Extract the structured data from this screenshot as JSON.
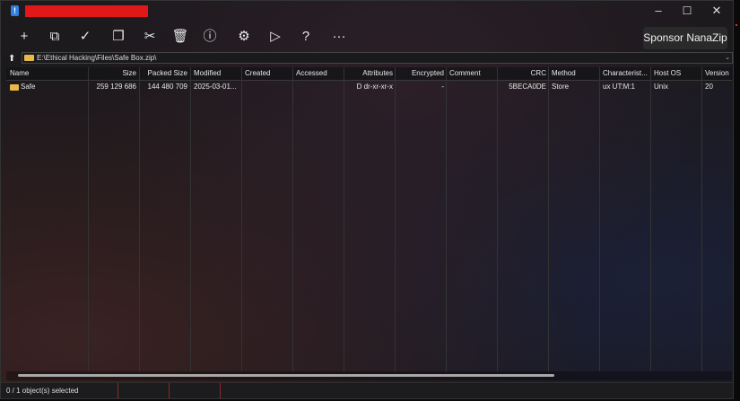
{
  "window": {
    "app_icon": "!",
    "controls": {
      "minimize": "–",
      "maximize": "☐",
      "close": "✕"
    }
  },
  "toolbar": {
    "buttons": [
      {
        "name": "add-icon",
        "glyph": "+"
      },
      {
        "name": "extract-icon",
        "glyph": "⧉"
      },
      {
        "name": "test-icon",
        "glyph": "✓"
      },
      {
        "name": "copy-icon",
        "glyph": "❐"
      },
      {
        "name": "move-icon",
        "glyph": "✂"
      },
      {
        "name": "delete-icon",
        "glyph": "🗑"
      },
      {
        "name": "info-icon",
        "glyph": "ⓘ"
      },
      {
        "name": "settings-icon",
        "glyph": "⚙"
      },
      {
        "name": "play-icon",
        "glyph": "▷"
      },
      {
        "name": "help-icon",
        "glyph": "?"
      },
      {
        "name": "more-icon",
        "glyph": "···"
      }
    ],
    "sponsor_label": "Sponsor NanaZip"
  },
  "address": {
    "up_icon": "⬆",
    "path": "E:\\Ethical Hacking\\Files\\Safe Box.zip\\",
    "chevron": "⌄"
  },
  "table": {
    "columns": [
      "Name",
      "Size",
      "Packed Size",
      "Modified",
      "Created",
      "Accessed",
      "Attributes",
      "Encrypted",
      "Comment",
      "CRC",
      "Method",
      "Characterist...",
      "Host OS",
      "Version"
    ],
    "rows": [
      {
        "name": "Safe",
        "size": "259 129 686",
        "packed_size": "144 480 709",
        "modified": "2025-03-01...",
        "created": "",
        "accessed": "",
        "attributes": "D dr-xr-xr-x",
        "encrypted": "-",
        "comment": "",
        "crc": "5BECA0DE",
        "method": "Store",
        "characteristics": "ux UT:M:1",
        "host_os": "Unix",
        "version": "20"
      }
    ]
  },
  "status": {
    "text": "0 / 1 object(s) selected"
  },
  "colors": {
    "folder": "#e8b84a",
    "redaction": "#e01818",
    "accent": "#2f7fe0"
  }
}
